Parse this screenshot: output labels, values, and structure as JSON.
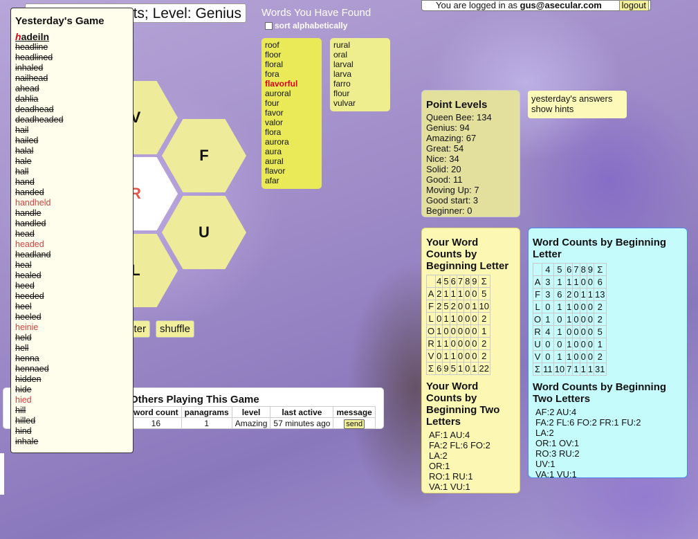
{
  "header": {
    "title_fragment": "ts; Level: Genius"
  },
  "login": {
    "prefix": "You are logged in as ",
    "user": "gus@asecular.com",
    "logout_label": "logout"
  },
  "found": {
    "title": "Words You Have Found",
    "sort_label": "sort alphabetically",
    "col1": [
      {
        "word": "roof",
        "pangram": false
      },
      {
        "word": "floor",
        "pangram": false
      },
      {
        "word": "floral",
        "pangram": false
      },
      {
        "word": "fora",
        "pangram": false
      },
      {
        "word": "flavorful",
        "pangram": true
      },
      {
        "word": "auroral",
        "pangram": false
      },
      {
        "word": "four",
        "pangram": false
      },
      {
        "word": "favor",
        "pangram": false
      },
      {
        "word": "valor",
        "pangram": false
      },
      {
        "word": "flora",
        "pangram": false
      },
      {
        "word": "aurora",
        "pangram": false
      },
      {
        "word": "aura",
        "pangram": false
      },
      {
        "word": "aural",
        "pangram": false
      },
      {
        "word": "flavor",
        "pangram": false
      },
      {
        "word": "afar",
        "pangram": false
      }
    ],
    "col2": [
      "rural",
      "oral",
      "larval",
      "larva",
      "farro",
      "flour",
      "vulvar"
    ]
  },
  "hexes": {
    "top_left": "V",
    "right_top": "F",
    "center": "R",
    "right_bottom": "U",
    "bottom_left": "L"
  },
  "controls": {
    "enter_fragment": "nter",
    "shuffle_label": "shuffle"
  },
  "point_levels": {
    "title": "Point Levels",
    "items": [
      "Queen Bee: 134",
      "Genius: 94",
      "Amazing: 67",
      "Great: 54",
      "Nice: 34",
      "Solid: 20",
      "Good: 11",
      "Moving Up: 7",
      "Good start: 3",
      "Beginner: 0"
    ]
  },
  "answers_box": {
    "answers_link": "yesterday's answers",
    "hints_link": "show hints"
  },
  "your_counts": {
    "title": "Your Word Counts by Beginning Letter",
    "header": [
      "",
      "4",
      "5",
      "6",
      "7",
      "8",
      "9",
      "Σ"
    ],
    "rows": [
      [
        "A",
        "2",
        "1",
        "1",
        "1",
        "0",
        "0",
        "5"
      ],
      [
        "F",
        "2",
        "5",
        "2",
        "0",
        "0",
        "1",
        "10"
      ],
      [
        "L",
        "0",
        "1",
        "1",
        "0",
        "0",
        "0",
        "2"
      ],
      [
        "O",
        "1",
        "0",
        "0",
        "0",
        "0",
        "0",
        "1"
      ],
      [
        "R",
        "1",
        "1",
        "0",
        "0",
        "0",
        "0",
        "2"
      ],
      [
        "V",
        "0",
        "1",
        "1",
        "0",
        "0",
        "0",
        "2"
      ],
      [
        "Σ",
        "6",
        "9",
        "5",
        "1",
        "0",
        "1",
        "22"
      ]
    ],
    "two_title": "Your Word Counts by Beginning Two Letters",
    "two_lines": [
      "AF:1 AU:4",
      "FA:2 FL:6 FO:2",
      "LA:2",
      "OR:1",
      "RO:1 RU:1",
      "VA:1 VU:1"
    ]
  },
  "all_counts": {
    "title": "Word Counts by Beginning Letter",
    "header": [
      "",
      "4",
      "5",
      "6",
      "7",
      "8",
      "9",
      "Σ"
    ],
    "rows": [
      [
        "A",
        "3",
        "1",
        "1",
        "1",
        "0",
        "0",
        "6"
      ],
      [
        "F",
        "3",
        "6",
        "2",
        "0",
        "1",
        "1",
        "13"
      ],
      [
        "L",
        "0",
        "1",
        "1",
        "0",
        "0",
        "0",
        "2"
      ],
      [
        "O",
        "1",
        "0",
        "1",
        "0",
        "0",
        "0",
        "2"
      ],
      [
        "R",
        "4",
        "1",
        "0",
        "0",
        "0",
        "0",
        "5"
      ],
      [
        "U",
        "0",
        "0",
        "1",
        "0",
        "0",
        "0",
        "1"
      ],
      [
        "V",
        "0",
        "1",
        "1",
        "0",
        "0",
        "0",
        "2"
      ],
      [
        "Σ",
        "11",
        "10",
        "7",
        "1",
        "1",
        "1",
        "31"
      ]
    ],
    "two_title": "Word Counts by Beginning Two Letters",
    "two_lines": [
      "AF:2 AU:4",
      "FA:2 FL:6 FO:2 FR:1 FU:2",
      "LA:2",
      "OR:1 OV:1",
      "RO:3 RU:2",
      "UV:1",
      "VA:1 VU:1"
    ]
  },
  "others": {
    "title_fragment": "Others Playing This Game",
    "columns": [
      "word count",
      "panagrams",
      "level",
      "last active",
      "message"
    ],
    "row": [
      "16",
      "1",
      "Amazing",
      "57 minutes ago"
    ],
    "send_label": "send"
  },
  "yesterday": {
    "title": "Yesterday's Game",
    "center_letter": "h",
    "other_letters": "adeiln",
    "words": [
      {
        "w": "headline",
        "found": true
      },
      {
        "w": "headlined",
        "found": true
      },
      {
        "w": "inhaled",
        "found": true
      },
      {
        "w": "nailhead",
        "found": true
      },
      {
        "w": "ahead",
        "found": true
      },
      {
        "w": "dahlia",
        "found": true
      },
      {
        "w": "deadhead",
        "found": true
      },
      {
        "w": "deadheaded",
        "found": true
      },
      {
        "w": "hail",
        "found": true
      },
      {
        "w": "hailed",
        "found": true
      },
      {
        "w": "halal",
        "found": true
      },
      {
        "w": "hale",
        "found": true
      },
      {
        "w": "hall",
        "found": true
      },
      {
        "w": "hand",
        "found": true
      },
      {
        "w": "handed",
        "found": true
      },
      {
        "w": "handheld",
        "found": false
      },
      {
        "w": "handle",
        "found": true
      },
      {
        "w": "handled",
        "found": true
      },
      {
        "w": "head",
        "found": true
      },
      {
        "w": "headed",
        "found": false
      },
      {
        "w": "headland",
        "found": true
      },
      {
        "w": "heal",
        "found": true
      },
      {
        "w": "healed",
        "found": true
      },
      {
        "w": "heed",
        "found": true
      },
      {
        "w": "heeded",
        "found": true
      },
      {
        "w": "heel",
        "found": true
      },
      {
        "w": "heeled",
        "found": true
      },
      {
        "w": "heinie",
        "found": false
      },
      {
        "w": "held",
        "found": true
      },
      {
        "w": "hell",
        "found": true
      },
      {
        "w": "henna",
        "found": true
      },
      {
        "w": "hennaed",
        "found": true
      },
      {
        "w": "hidden",
        "found": true
      },
      {
        "w": "hide",
        "found": true
      },
      {
        "w": "hied",
        "found": false
      },
      {
        "w": "hill",
        "found": true
      },
      {
        "w": "hilled",
        "found": true
      },
      {
        "w": "hind",
        "found": true
      },
      {
        "w": "inhale",
        "found": true
      }
    ]
  }
}
